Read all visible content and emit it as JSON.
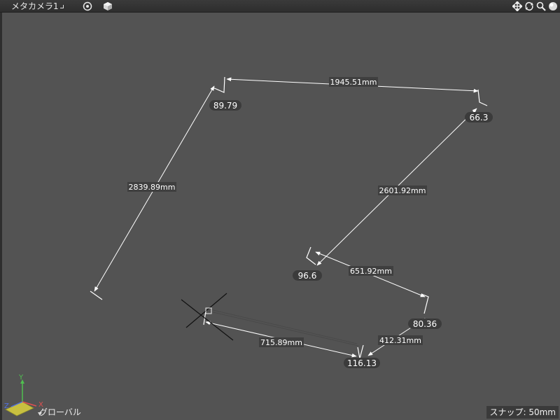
{
  "titlebar": {
    "camera_title": "メタカメラ1",
    "left_icons": [
      "target-icon",
      "cube-icon"
    ],
    "right_icons": [
      "move-icon",
      "rotate-icon",
      "zoom-icon",
      "sphere-icon"
    ]
  },
  "measurements": {
    "dimensions": [
      "1945.51mm",
      "2839.89mm",
      "2601.92mm",
      "651.92mm",
      "715.89mm",
      "412.31mm"
    ],
    "angles": [
      "89.79",
      "66.3",
      "96.6",
      "80.36",
      "116.13"
    ]
  },
  "axis_gizmo": {
    "y": "Y",
    "x": "X",
    "z": "Z"
  },
  "coordinate_mode": "グローバル",
  "snap_status": "スナップ: 50mm",
  "colors": {
    "viewport_bg": "#535353",
    "dimension_line": "#ffffff",
    "axis_x": "#e05050",
    "axis_y": "#50c050",
    "axis_z": "#5070e0"
  }
}
